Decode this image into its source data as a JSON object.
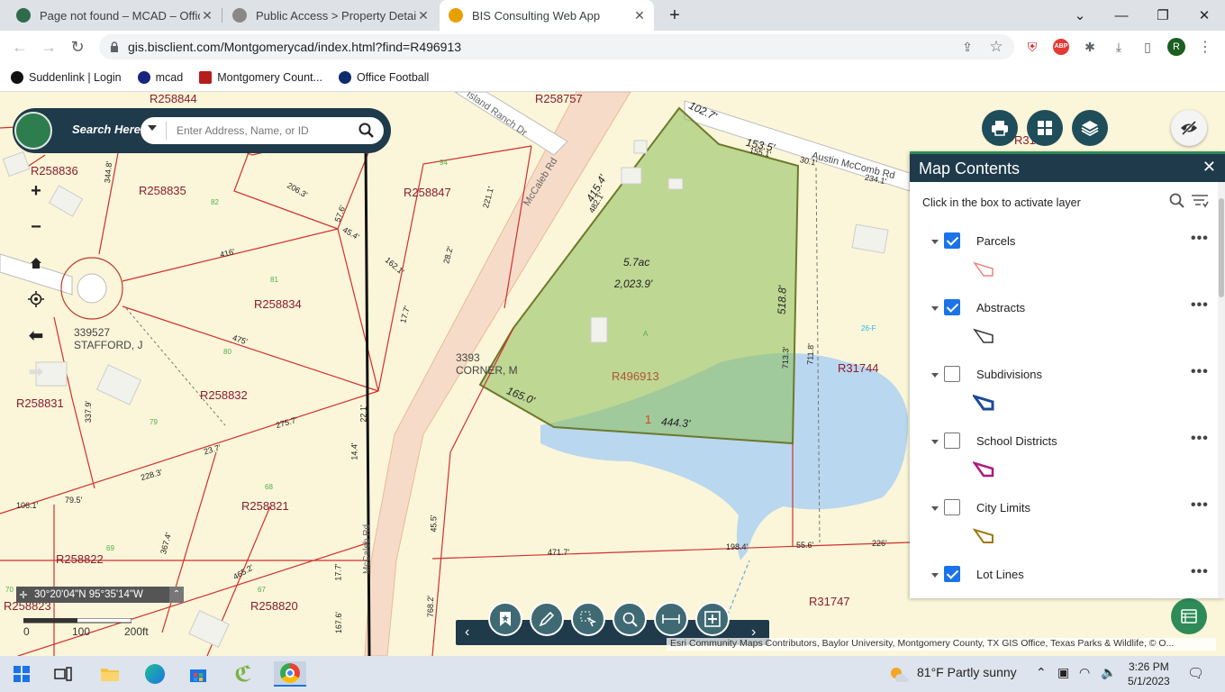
{
  "browser": {
    "tabs": [
      {
        "title": "Page not found – MCAD – Officia",
        "active": false,
        "favicon_color": "#2e6b4a"
      },
      {
        "title": "Public Access > Property Detail",
        "active": false,
        "favicon_color": "#777777"
      },
      {
        "title": "BIS Consulting Web App",
        "active": true,
        "favicon_color": "#e6a100"
      }
    ],
    "new_tab": "+",
    "window_controls": {
      "chevron": "⌄",
      "minimize": "—",
      "restore": "❐",
      "close": "✕"
    },
    "url": "gis.bisclient.com/Montgomerycad/index.html?find=R496913",
    "bookmarks": [
      {
        "label": "Suddenlink | Login",
        "color": "#111111"
      },
      {
        "label": "mcad",
        "color": "#1a237e"
      },
      {
        "label": "Montgomery Count...",
        "color": "#b71c1c"
      },
      {
        "label": "Office Football",
        "color": "#0d2c6b"
      }
    ],
    "profile_initial": "R",
    "abp": "ABP"
  },
  "search": {
    "label": "Search Here:",
    "placeholder": "Enter Address, Name, or ID"
  },
  "map": {
    "parcel_labels": [
      {
        "text": "R258844"
      },
      {
        "text": "R258757"
      },
      {
        "text": "R258836"
      },
      {
        "text": "R258835"
      },
      {
        "text": "R258847"
      },
      {
        "text": "R258834"
      },
      {
        "text": "R258832"
      },
      {
        "text": "R258831"
      },
      {
        "text": "R258821"
      },
      {
        "text": "R258822"
      },
      {
        "text": "R258820"
      },
      {
        "text": "R258823"
      },
      {
        "text": "R31744"
      },
      {
        "text": "R31747"
      },
      {
        "text": "R31"
      }
    ],
    "dimension_labels": [
      "102.7'",
      "153.5'",
      "155.1'",
      "30.1'",
      "234.1'",
      "415.4'",
      "482.1'",
      "518.8'",
      "165.0'",
      "444.3'",
      "713.3'",
      "711.8'",
      "344.8'",
      "206.3'",
      "57.6'",
      "45.4'",
      "416'",
      "475'",
      "162.1'",
      "17.7'",
      "221.1'",
      "28.2'",
      "275.7'",
      "228.3'",
      "23.7'",
      "106.1'",
      "79.5'",
      "337.9'",
      "367.4'",
      "465.2'",
      "471.7'",
      "198.4'",
      "55.6'",
      "226'",
      "768.2'",
      "45.5'",
      "17.7'",
      "167.6'",
      "14.4'",
      "22.1'"
    ],
    "road_labels": [
      "McCaleb Rd",
      "Austin McComb Rd",
      "Island Ranch Dr",
      "McCaleb Rd"
    ],
    "owner_labels": [
      {
        "text": "339527\nSTAFFORD, J"
      },
      {
        "text": "3393\nCORNER, M"
      }
    ],
    "selected_parcel": {
      "id": "R496913",
      "acres": "5.7ac",
      "sub": "2,023.9'",
      "marker": "1"
    },
    "small_numbers": [
      "94",
      "82",
      "81",
      "80",
      "79",
      "68",
      "69",
      "67",
      "70",
      "26-F",
      "A"
    ],
    "coords": "30°20'04\"N 95°35'14\"W",
    "scale": [
      "0",
      "100",
      "200ft"
    ],
    "attribution": "Esri Community Maps Contributors, Baylor University, Montgomery County, TX GIS Office, Texas Parks & Wildlife, © O..."
  },
  "panel": {
    "title": "Map Contents",
    "close": "✕",
    "hint": "Click in the box to activate layer",
    "layers": [
      {
        "name": "Parcels",
        "checked": true,
        "color": "#f08080"
      },
      {
        "name": "Abstracts",
        "checked": true,
        "color": "#333333"
      },
      {
        "name": "Subdivisions",
        "checked": false,
        "color": "#1a4a9a"
      },
      {
        "name": "School Districts",
        "checked": false,
        "color": "#b0187a"
      },
      {
        "name": "City Limits",
        "checked": false,
        "color": "#a07810"
      },
      {
        "name": "Lot Lines",
        "checked": true,
        "color": "#333333"
      }
    ],
    "more": "•••"
  },
  "taskbar": {
    "weather": "81°F  Partly sunny",
    "time": "3:26 PM",
    "date": "5/1/2023"
  }
}
